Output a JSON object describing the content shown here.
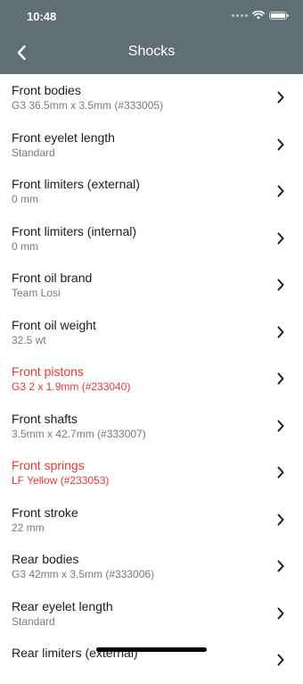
{
  "status_bar": {
    "time": "10:48"
  },
  "nav": {
    "title": "Shocks",
    "back_icon": "chevron-left-icon"
  },
  "colors": {
    "header_bg": "#5f6f75",
    "alert": "#e53935",
    "subtitle": "#7a7a7f"
  },
  "list": {
    "items": [
      {
        "title": "Front bodies",
        "value": "G3 36.5mm x 3.5mm (#333005)",
        "alert": false
      },
      {
        "title": "Front eyelet length",
        "value": "Standard",
        "alert": false
      },
      {
        "title": "Front limiters (external)",
        "value": "0 mm",
        "alert": false
      },
      {
        "title": "Front limiters (internal)",
        "value": "0 mm",
        "alert": false
      },
      {
        "title": "Front oil brand",
        "value": "Team Losi",
        "alert": false
      },
      {
        "title": "Front oil weight",
        "value": "32.5 wt",
        "alert": false
      },
      {
        "title": "Front pistons",
        "value": "G3 2 x 1.9mm (#233040)",
        "alert": true
      },
      {
        "title": "Front shafts",
        "value": "3.5mm x 42.7mm (#333007)",
        "alert": false
      },
      {
        "title": "Front springs",
        "value": "LF Yellow (#233053)",
        "alert": true
      },
      {
        "title": "Front stroke",
        "value": "22 mm",
        "alert": false
      },
      {
        "title": "Rear bodies",
        "value": "G3 42mm x 3.5mm (#333006)",
        "alert": false
      },
      {
        "title": "Rear eyelet length",
        "value": "Standard",
        "alert": false
      },
      {
        "title": "Rear limiters (external)",
        "value": "",
        "alert": false
      }
    ]
  }
}
